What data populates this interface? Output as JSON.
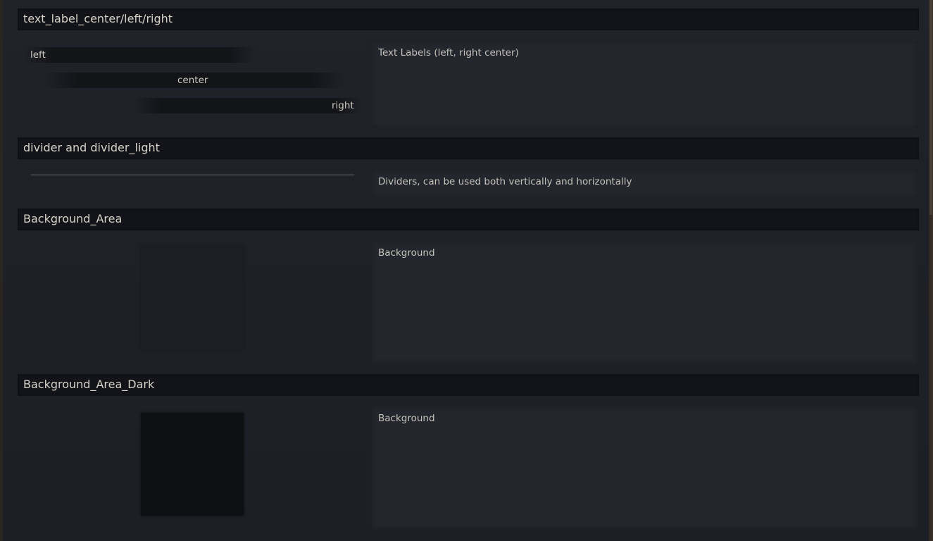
{
  "sections": [
    {
      "title": "text_label_center/left/right",
      "description": "Text Labels (left, right center)",
      "labels": {
        "left": "left",
        "center": "center",
        "right": "right"
      }
    },
    {
      "title": "divider and divider_light",
      "description": "Dividers, can be used both vertically and horizontally"
    },
    {
      "title": "Background_Area",
      "description": "Background"
    },
    {
      "title": "Background_Area_Dark",
      "description": "Background"
    }
  ]
}
